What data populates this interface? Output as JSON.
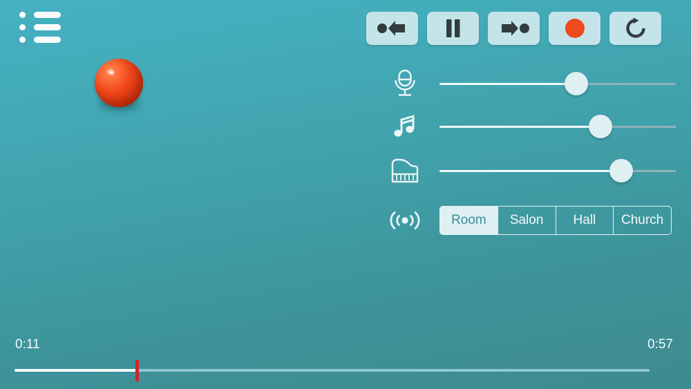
{
  "app": {
    "title": "Music Recorder",
    "background_top": "#45b1c2",
    "background_bottom": "#3d8b90",
    "accent_record": "#ef4a1e",
    "button_face": "#c5e4ea",
    "light_text": "#f3fafb"
  },
  "menu": {
    "label": "List",
    "icon": "list-icon"
  },
  "transport": {
    "buttons": [
      {
        "id": "rewind-to-start",
        "label": "Go to beginning",
        "icon": "rewind-to-start-icon"
      },
      {
        "id": "pause",
        "label": "Pause",
        "icon": "pause-icon"
      },
      {
        "id": "forward-to-end",
        "label": "Go to end",
        "icon": "forward-to-end-icon"
      },
      {
        "id": "record",
        "label": "Record",
        "icon": "record-icon"
      },
      {
        "id": "loop",
        "label": "Loop",
        "icon": "loop-icon"
      }
    ]
  },
  "stage": {
    "ball": {
      "label": "Bouncing ball",
      "color": "#ef4a1e"
    }
  },
  "mixer": {
    "sliders": [
      {
        "id": "microphone",
        "label": "Microphone volume",
        "icon": "microphone-icon",
        "value": 58
      },
      {
        "id": "music",
        "label": "Music volume",
        "icon": "music-note-icon",
        "value": 68
      },
      {
        "id": "piano",
        "label": "Piano volume",
        "icon": "piano-icon",
        "value": 77
      }
    ],
    "reverb": {
      "label": "Reverb",
      "icon": "broadcast-icon",
      "selected": "Room",
      "options": [
        "Room",
        "Salon",
        "Hall",
        "Church"
      ]
    }
  },
  "timeline": {
    "current_time": "0:11",
    "total_time": "0:57",
    "progress_percent": 19.3
  }
}
